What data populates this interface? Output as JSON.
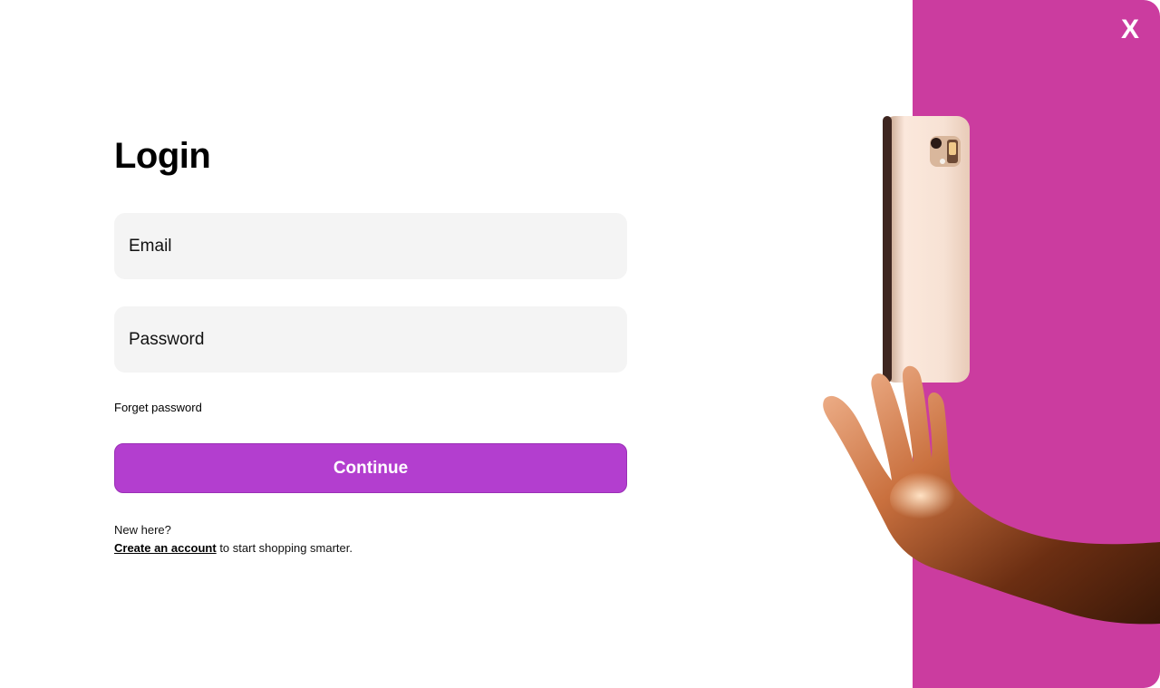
{
  "login": {
    "title": "Login",
    "email_placeholder": "Email",
    "password_placeholder": "Password",
    "forget_password_label": "Forget password",
    "continue_label": "Continue",
    "new_here_text": "New here?",
    "create_account_label": "Create an account",
    "create_account_suffix": " to start shopping smarter."
  },
  "promo": {
    "close_label": "X",
    "image_icon": "phone-floating-above-hand-illustration",
    "background_color": "#cb3c9f"
  },
  "colors": {
    "accent": "#b33ecf",
    "field_background": "#f4f4f4",
    "panel": "#cb3c9f"
  }
}
